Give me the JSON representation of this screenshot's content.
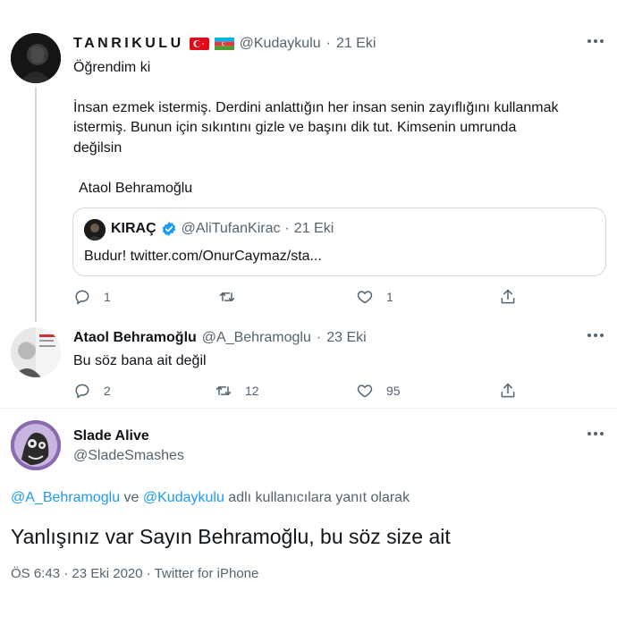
{
  "tweet1": {
    "display_name": "TANRIKULU",
    "handle": "@Kudaykulu",
    "sep": "·",
    "date": "21 Eki",
    "lines": [
      "Öğrendim ki",
      "İnsan ezmek istermiş. Derdini anlattığın her insan senin zayıflığını kullanmak",
      "istermiş. Bunun için sıkıntını gizle ve başını dik tut. Kimsenin umrunda",
      "değilsin",
      "Ataol Behramoğlu"
    ],
    "quote": {
      "display_name": "KIRAÇ",
      "handle": "@AliTufanKirac",
      "sep": "·",
      "date": "21 Eki",
      "text": "Budur! twitter.com/OnurCaymaz/sta..."
    },
    "actions": {
      "reply": "1",
      "retweet": "",
      "like": "1"
    },
    "flags": [
      "turkey-flag",
      "azerbaijan-flag"
    ]
  },
  "tweet2": {
    "display_name": "Ataol Behramoğlu",
    "handle": "@A_Behramoglu",
    "sep": "·",
    "date": "23 Eki",
    "text": "Bu söz bana ait değil",
    "actions": {
      "reply": "2",
      "retweet": "12",
      "like": "95"
    }
  },
  "main": {
    "display_name": "Slade Alive",
    "handle": "@SladeSmashes",
    "reply_to": {
      "user1": "@A_Behramoglu",
      "conj": " ve ",
      "user2": "@Kudaykulu",
      "suffix": " adlı kullanıcılara yanıt olarak"
    },
    "text": "Yanlışınız var Sayın Behramoğlu, bu söz size ait",
    "footer": "ÖS 6:43 · 23 Eki 2020 · Twitter for iPhone"
  },
  "icons": {
    "more": "more-icon",
    "reply": "reply-icon",
    "retweet": "retweet-icon",
    "like": "like-icon",
    "share": "share-icon",
    "verified": "verified-badge-icon"
  },
  "colors": {
    "accent": "#1d9bf0",
    "text": "#0f1419",
    "muted": "#536471",
    "border": "#cfd9de"
  }
}
